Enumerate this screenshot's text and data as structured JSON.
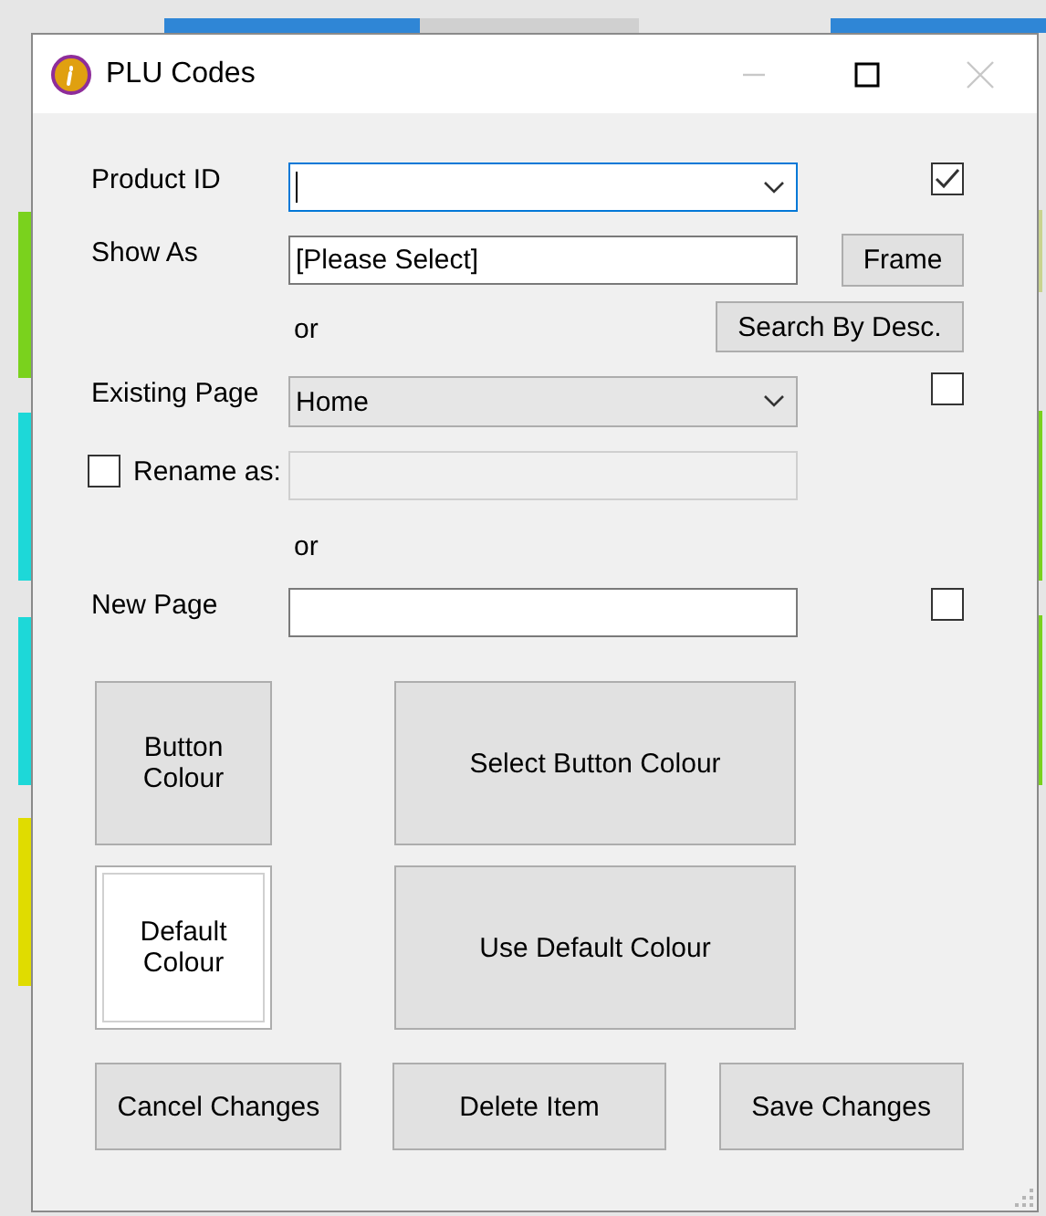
{
  "window": {
    "title": "PLU Codes",
    "controls": [
      {
        "kind": "minimize",
        "disabled": true
      },
      {
        "kind": "maximize",
        "disabled": false
      },
      {
        "kind": "close",
        "disabled": true
      }
    ]
  },
  "product_id": {
    "label": "Product ID",
    "focused": true,
    "checked": true
  },
  "show_as": {
    "label": "Show As",
    "value": "[Please Select]",
    "button": "Frame"
  },
  "or_1": "or",
  "search_button": "Search By Desc.",
  "existing_page": {
    "label": "Existing Page",
    "value": "Home",
    "checked": false
  },
  "rename": {
    "label": "Rename as:",
    "checked": false,
    "disabled": true
  },
  "or_2": "or",
  "new_page": {
    "label": "New Page",
    "checked": false
  },
  "colour_swatches": [
    {
      "label": "Button Colour",
      "color": "#e1e1e1"
    },
    {
      "label": "Default Colour",
      "color": "#ffffff"
    }
  ],
  "colour_buttons": [
    "Select Button Colour",
    "Use Default Colour"
  ],
  "footer_buttons": [
    "Cancel Changes",
    "Delete Item",
    "Save Changes"
  ]
}
